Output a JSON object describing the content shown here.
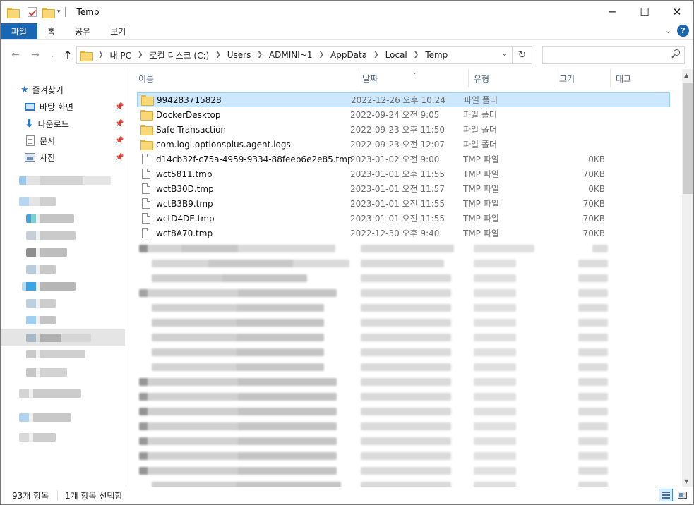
{
  "window": {
    "title": "Temp"
  },
  "ribbon": {
    "tabs": [
      "파일",
      "홈",
      "공유",
      "보기"
    ]
  },
  "address": {
    "crumbs": [
      "내 PC",
      "로컬 디스크 (C:)",
      "Users",
      "ADMINI~1",
      "AppData",
      "Local",
      "Temp"
    ]
  },
  "search": {
    "placeholder": ""
  },
  "quick_access": {
    "header": "즐겨찾기",
    "items": [
      {
        "label": "바탕 화면",
        "icon": "desktop-icon"
      },
      {
        "label": "다운로드",
        "icon": "download-icon"
      },
      {
        "label": "문서",
        "icon": "document-icon"
      },
      {
        "label": "사진",
        "icon": "pictures-icon"
      }
    ]
  },
  "columns": {
    "name": "이름",
    "date": "날짜",
    "type": "유형",
    "size": "크기",
    "tags": "태그"
  },
  "files": [
    {
      "name": "994283715828",
      "date": "2022-12-26 오후 10:24",
      "type": "파일 폴더",
      "size": "",
      "kind": "folder",
      "selected": true
    },
    {
      "name": "DockerDesktop",
      "date": "2022-09-24 오전 9:05",
      "type": "파일 폴더",
      "size": "",
      "kind": "folder"
    },
    {
      "name": "Safe Transaction",
      "date": "2022-09-23 오후 11:50",
      "type": "파일 폴더",
      "size": "",
      "kind": "folder"
    },
    {
      "name": "com.logi.optionsplus.agent.logs",
      "date": "2022-09-23 오전 12:07",
      "type": "파일 폴더",
      "size": "",
      "kind": "folder"
    },
    {
      "name": "d14cb32f-c75a-4959-9334-88feeb6e2e85.tmp",
      "date": "2023-01-02 오전 9:00",
      "type": "TMP 파일",
      "size": "0KB",
      "kind": "file"
    },
    {
      "name": "wct5811.tmp",
      "date": "2023-01-01 오후 11:55",
      "type": "TMP 파일",
      "size": "70KB",
      "kind": "file"
    },
    {
      "name": "wctB30D.tmp",
      "date": "2023-01-01 오전 11:57",
      "type": "TMP 파일",
      "size": "0KB",
      "kind": "file"
    },
    {
      "name": "wctB3B9.tmp",
      "date": "2023-01-01 오전 11:55",
      "type": "TMP 파일",
      "size": "70KB",
      "kind": "file"
    },
    {
      "name": "wctD4DE.tmp",
      "date": "2023-01-01 오전 11:55",
      "type": "TMP 파일",
      "size": "70KB",
      "kind": "file"
    },
    {
      "name": "wct8A70.tmp",
      "date": "2022-12-30 오후 9:40",
      "type": "TMP 파일",
      "size": "70KB",
      "kind": "file"
    }
  ],
  "status": {
    "item_count": "93개 항목",
    "selection": "1개 항목 선택함"
  }
}
